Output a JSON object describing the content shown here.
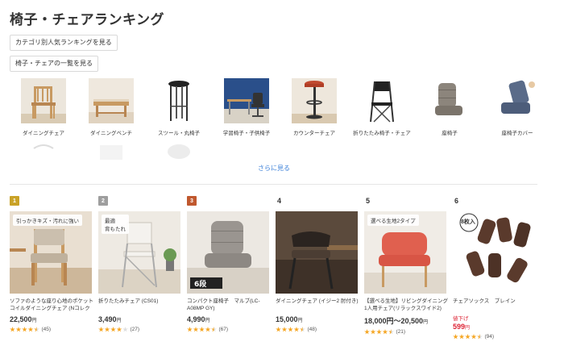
{
  "page": {
    "title": "椅子・チェアランキング"
  },
  "links": {
    "category_ranking": "カテゴリ別人気ランキングを見る",
    "list_all": "椅子・チェアの一覧を見る",
    "see_more": "さらに見る"
  },
  "categories": [
    {
      "label": "ダイニングチェア",
      "icon": "wooden-chair-image"
    },
    {
      "label": "ダイニングベンチ",
      "icon": "bench-image"
    },
    {
      "label": "スツール・丸椅子",
      "icon": "stool-image"
    },
    {
      "label": "学習椅子・子供椅子",
      "icon": "desk-chair-image"
    },
    {
      "label": "カウンターチェア",
      "icon": "bar-stool-image"
    },
    {
      "label": "折りたたみ椅子・チェア",
      "icon": "folding-chair-image"
    },
    {
      "label": "座椅子",
      "icon": "floor-chair-image"
    },
    {
      "label": "座椅子カバー",
      "icon": "floor-chair-cover-image"
    }
  ],
  "ranking": [
    {
      "rank": "1",
      "badge_color": "#c9a227",
      "tag": "引っかきキズ・汚れに強い",
      "name": "ソファのような座り心地のポケットコイルダイニングチェア (Nコレクション",
      "price": "22,500",
      "yen": "円",
      "stars": 4.5,
      "reviews": "(45)"
    },
    {
      "rank": "2",
      "badge_color": "#9e9e9e",
      "tag": "最適\n背もたれ",
      "name": "折りたたみチェア (CS01)",
      "price": "3,490",
      "yen": "円",
      "stars": 4,
      "reviews": "(27)"
    },
    {
      "rank": "3",
      "badge_color": "#c0582e",
      "tag": "",
      "name": "コンパクト座椅子　マルブ(LC-A08MP GY)",
      "price": "4,990",
      "yen": "円",
      "stars": 4.5,
      "reviews": "(67)"
    },
    {
      "rank": "4",
      "badge_color": "",
      "tag": "",
      "name": "ダイニングチェア (イジー2 肘付き)",
      "price": "15,000",
      "yen": "円",
      "stars": 4.5,
      "reviews": "(48)"
    },
    {
      "rank": "5",
      "badge_color": "",
      "tag": "選べる生地2タイプ",
      "name": "【選べる生地】リビングダイニング1人用チェア(リラックスワイド2)",
      "price": "18,000円～20,500",
      "yen": "円",
      "stars": 4.5,
      "reviews": "(21)"
    },
    {
      "rank": "6",
      "badge_color": "",
      "tag": "8枚入",
      "name": "チェアソックス　プレイン",
      "sale": "値下げ",
      "price": "599",
      "yen": "円",
      "stars": 4.5,
      "reviews": "(94)"
    }
  ]
}
